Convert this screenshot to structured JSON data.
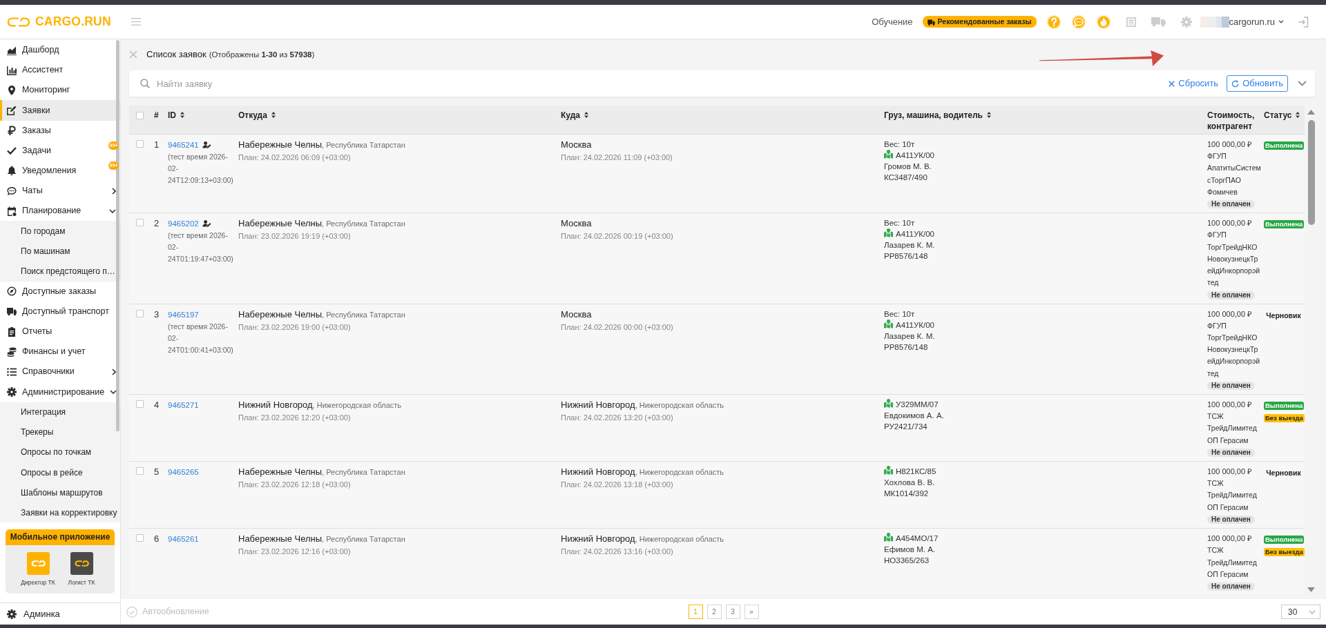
{
  "header": {
    "brand": "CARGO.RUN",
    "training_link": "Обучение",
    "recommended_button": "Рекомендованные заказы",
    "toolbar_icons": [
      {
        "highlighted": true
      },
      {
        "highlighted": true
      },
      {
        "highlighted": true
      },
      {
        "highlighted": false
      },
      {
        "highlighted": false
      },
      {
        "highlighted": false
      }
    ],
    "account": "cargorun.ru"
  },
  "sidebar": {
    "items": [
      {
        "label": "Дашборд",
        "selected": false
      },
      {
        "label": "Ассистент",
        "selected": false
      },
      {
        "label": "Мониторинг",
        "selected": false
      },
      {
        "label": "Заявки",
        "selected": true
      },
      {
        "label": "Заказы",
        "selected": false
      },
      {
        "label": "Задачи",
        "selected": false,
        "badge": "99+"
      },
      {
        "label": "Уведомления",
        "selected": false,
        "badge": "99+"
      },
      {
        "label": "Чаты",
        "selected": false,
        "expanded": false
      },
      {
        "label": "Планирование",
        "selected": false,
        "expanded": true,
        "children": [
          {
            "label": "По городам",
            "selected": false
          },
          {
            "label": "По машинам",
            "selected": false
          },
          {
            "label": "Поиск предстоящего п…",
            "selected": false
          }
        ]
      },
      {
        "label": "Доступные заказы",
        "selected": false
      },
      {
        "label": "Доступный транспорт",
        "selected": false
      },
      {
        "label": "Отчеты",
        "selected": false
      },
      {
        "label": "Финансы и учет",
        "selected": false
      },
      {
        "label": "Справочники",
        "selected": false,
        "expanded": false
      },
      {
        "label": "Администрирование",
        "selected": false,
        "expanded": true,
        "children": [
          {
            "label": "Интеграция",
            "selected": false
          },
          {
            "label": "Трекеры",
            "selected": false
          },
          {
            "label": "Опросы по точкам",
            "selected": false
          },
          {
            "label": "Опросы в рейсе",
            "selected": false
          },
          {
            "label": "Шаблоны маршрутов",
            "selected": false
          },
          {
            "label": "Заявки на корректировку",
            "selected": false
          }
        ]
      }
    ],
    "mobile_app": {
      "title": "Мобильное приложение",
      "apps": [
        {
          "label": "Директор ТК",
          "color": "#ffb300"
        },
        {
          "label": "Логист ТК",
          "color": "#4a4a4a"
        }
      ]
    },
    "footer_item": {
      "label": "Админка",
      "selected": false
    }
  },
  "page": {
    "title": "Список заявок",
    "count": "(Отображены **1-30** из **57938**)",
    "search": {
      "placeholder": "Найти заявку"
    },
    "reset_label": "Сбросить",
    "refresh_label": "Обновить"
  },
  "table": {
    "select_all": {
      "checked": false
    },
    "columns": [
      {
        "label": "#",
        "sortable": false
      },
      {
        "label": "ID",
        "sortable": true
      },
      {
        "label": "Откуда",
        "sortable": true
      },
      {
        "label": "Куда",
        "sortable": true
      },
      {
        "label": "Груз, машина, водитель",
        "sortable": true
      },
      {
        "label": "Стоимость, контрагент",
        "sortable": false
      },
      {
        "label": "Статус",
        "sortable": true
      }
    ],
    "rows": [
      {
        "checked": false,
        "number": "1",
        "id": "9465241",
        "user_mark": true,
        "note": "(тест время 2026-02-24T12:09:13+03:00)",
        "from": {
          "city": "Набережные Челны",
          "region": ", Республика Татарстан",
          "plan": "План: 24.02.2026 06:09 (+03:00)"
        },
        "to": {
          "city": "Москва",
          "plan": "План: 24.02.2026 11:09 (+03:00)"
        },
        "cargo": {
          "weight": "Вес: 10т",
          "vehicle": "А411УК/00",
          "driver": "Громов М. В.",
          "trailer": "КС3487/490"
        },
        "cost": "100 000,00 ₽",
        "contractor": "ФГУП АпатитыСистемсТоргПАО Фомичев",
        "payment": "Не оплачен",
        "statuses": [
          {
            "kind": "success",
            "label": "Выполнена"
          }
        ]
      },
      {
        "checked": false,
        "number": "2",
        "id": "9465202",
        "user_mark": true,
        "note": "(тест время 2026-02-24T01:19:47+03:00)",
        "from": {
          "city": "Набережные Челны",
          "region": ", Республика Татарстан",
          "plan": "План: 23.02.2026 19:19 (+03:00)"
        },
        "to": {
          "city": "Москва",
          "plan": "План: 24.02.2026 00:19 (+03:00)"
        },
        "cargo": {
          "weight": "Вес: 10т",
          "vehicle": "А411УК/00",
          "driver": "Лазарев К. М.",
          "trailer": "РР8576/148"
        },
        "cost": "100 000,00 ₽",
        "contractor": "ФГУП ТоргТрейдНКО НовокузнецкТрейдИнкорпорэйтед",
        "payment": "Не оплачен",
        "statuses": [
          {
            "kind": "success",
            "label": "Выполнена"
          }
        ]
      },
      {
        "checked": false,
        "number": "3",
        "id": "9465197",
        "user_mark": false,
        "note": "(тест время 2026-02-24T01:00:41+03:00)",
        "from": {
          "city": "Набережные Челны",
          "region": ", Республика Татарстан",
          "plan": "План: 23.02.2026 19:00 (+03:00)"
        },
        "to": {
          "city": "Москва",
          "plan": "План: 24.02.2026 00:00 (+03:00)"
        },
        "cargo": {
          "weight": "Вес: 10т",
          "vehicle": "А411УК/00",
          "driver": "Лазарев К. М.",
          "trailer": "РР8576/148"
        },
        "cost": "100 000,00 ₽",
        "contractor": "ФГУП ТоргТрейдНКО НовокузнецкТрейдИнкорпорэйтед",
        "payment": "Не оплачен",
        "statuses": [
          {
            "kind": "plain",
            "label": "Черновик"
          }
        ]
      },
      {
        "checked": false,
        "number": "4",
        "id": "9465271",
        "user_mark": false,
        "from": {
          "city": "Нижний Новгород",
          "region": ", Нижегородская область",
          "plan": "План: 23.02.2026 12:20 (+03:00)"
        },
        "to": {
          "city": "Нижний Новгород",
          "region": ", Нижегородская область",
          "plan": "План: 24.02.2026 13:20 (+03:00)"
        },
        "cargo": {
          "vehicle": "У329ММ/07",
          "driver": "Евдокимов А. А.",
          "trailer": "РУ2421/734"
        },
        "cost": "100 000,00 ₽",
        "contractor": "ТСЖ ТрейдЛимитед ОП Герасим",
        "payment": "Не оплачен",
        "statuses": [
          {
            "kind": "success",
            "label": "Выполнена"
          },
          {
            "kind": "warning",
            "label": "Без выезда"
          }
        ]
      },
      {
        "checked": false,
        "number": "5",
        "id": "9465265",
        "user_mark": false,
        "from": {
          "city": "Набережные Челны",
          "region": ", Республика Татарстан",
          "plan": "План: 23.02.2026 12:18 (+03:00)"
        },
        "to": {
          "city": "Нижний Новгород",
          "region": ", Нижегородская область",
          "plan": "План: 24.02.2026 13:18 (+03:00)"
        },
        "cargo": {
          "vehicle": "Н821КС/85",
          "driver": "Хохлова В. В.",
          "trailer": "МК1014/392"
        },
        "cost": "100 000,00 ₽",
        "contractor": "ТСЖ ТрейдЛимитед ОП Герасим",
        "payment": "Не оплачен",
        "statuses": [
          {
            "kind": "plain",
            "label": "Черновик"
          }
        ]
      },
      {
        "checked": false,
        "number": "6",
        "id": "9465261",
        "user_mark": false,
        "from": {
          "city": "Набережные Челны",
          "region": ", Республика Татарстан",
          "plan": "План: 23.02.2026 12:16 (+03:00)"
        },
        "to": {
          "city": "Нижний Новгород",
          "region": ", Нижегородская область",
          "plan": "План: 24.02.2026 13:16 (+03:00)"
        },
        "cargo": {
          "vehicle": "А454МО/17",
          "driver": "Ефимов М. А.",
          "trailer": "НО3365/263"
        },
        "cost": "100 000,00 ₽",
        "contractor": "ТСЖ ТрейдЛимитед ОП Герасим",
        "payment": "Не оплачен",
        "statuses": [
          {
            "kind": "success",
            "label": "Выполнена"
          },
          {
            "kind": "warning",
            "label": "Без выезда"
          }
        ]
      }
    ]
  },
  "footer": {
    "autorefresh": {
      "label": "Автообновление",
      "on": false
    },
    "pages": [
      {
        "label": "1",
        "selected": true
      },
      {
        "label": "2",
        "selected": false
      },
      {
        "label": "3",
        "selected": false
      },
      {
        "label": "»",
        "selected": false
      }
    ],
    "page_size": "30"
  }
}
